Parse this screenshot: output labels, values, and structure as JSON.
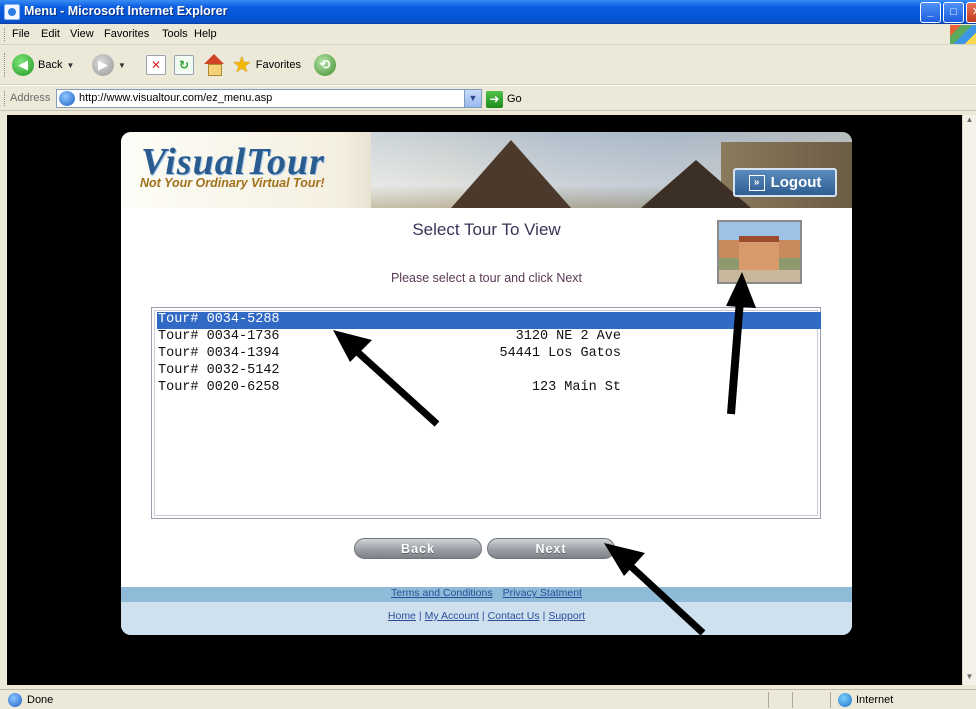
{
  "window": {
    "title": "Menu - Microsoft Internet Explorer",
    "controls": {
      "minimize": "_",
      "maximize": "□",
      "close": "✕"
    }
  },
  "menubar": {
    "items": [
      "File",
      "Edit",
      "View",
      "Favorites",
      "Tools",
      "Help"
    ]
  },
  "toolbar": {
    "back_label": "Back",
    "favorites_label": "Favorites"
  },
  "address": {
    "label": "Address",
    "url": "http://www.visualtour.com/ez_menu.asp",
    "go_label": "Go"
  },
  "site": {
    "logo_text": "VisualTour",
    "tagline": "Not Your Ordinary Virtual Tour!",
    "logout_label": "Logout",
    "title": "Select Tour To View",
    "instruction": "Please select a tour and click Next",
    "tours": [
      {
        "number": "Tour# 0034-5288",
        "address": "",
        "selected": true
      },
      {
        "number": "Tour# 0034-1736",
        "address": "3120 NE 2 Ave",
        "selected": false
      },
      {
        "number": "Tour# 0034-1394",
        "address": "54441 Los Gatos",
        "selected": false
      },
      {
        "number": "Tour# 0032-5142",
        "address": "",
        "selected": false
      },
      {
        "number": "Tour# 0020-6258",
        "address": "123 Main St",
        "selected": false
      }
    ],
    "back_button": "Back",
    "next_button": "Next",
    "footer_links_top": [
      "Terms and Conditions",
      "Privacy Statment"
    ],
    "footer_links_bottom": [
      "Home",
      "My Account",
      "Contact Us",
      "Support"
    ],
    "footer_separator": "|"
  },
  "status": {
    "text": "Done",
    "zone": "Internet"
  },
  "colors": {
    "selection": "#316ac5",
    "xp_blue": "#0456d6",
    "logout_blue": "#2f5f92",
    "footer_band": "#8dbbd8"
  }
}
